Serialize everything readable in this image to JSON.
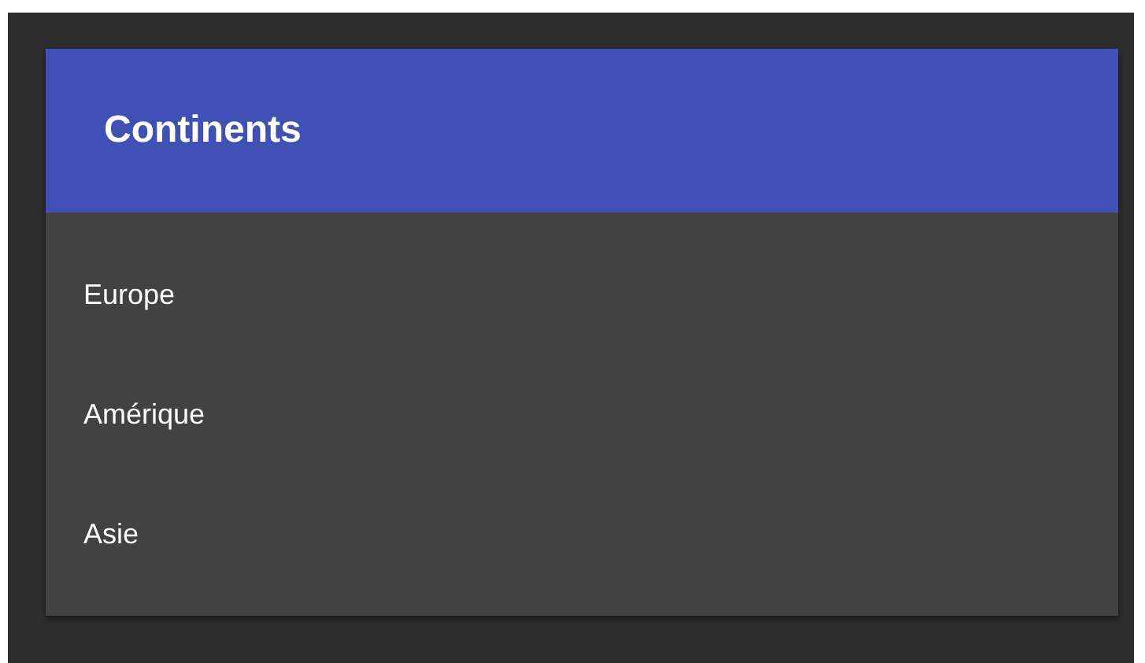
{
  "card": {
    "title": "Continents",
    "items": [
      {
        "label": "Europe"
      },
      {
        "label": "Amérique"
      },
      {
        "label": "Asie"
      }
    ]
  }
}
